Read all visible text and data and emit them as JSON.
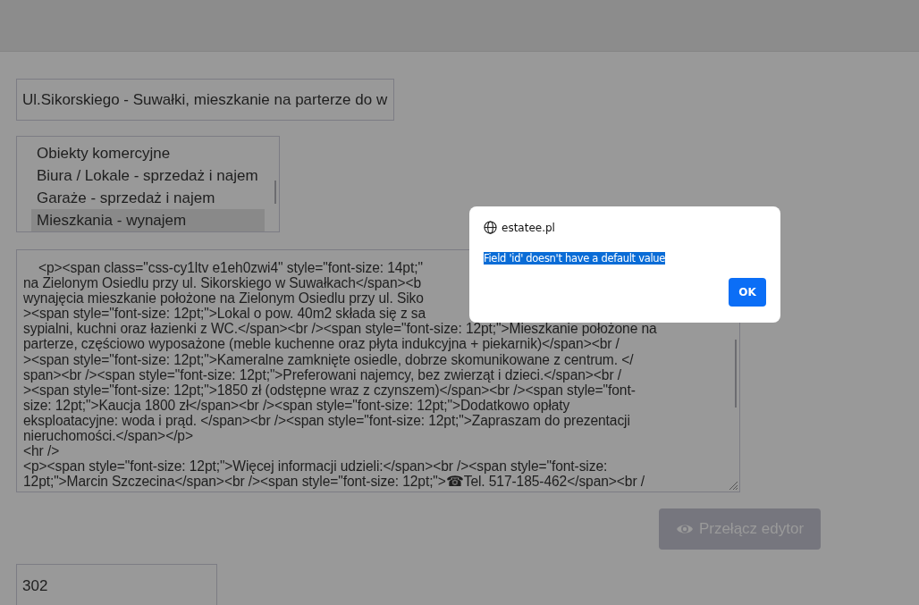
{
  "title_field": {
    "value": "Ul.Sikorskiego - Suwałki, mieszkanie na parterze do w"
  },
  "category_list": {
    "items": [
      {
        "label": "Obiekty komercyjne",
        "selected": false
      },
      {
        "label": "Biura / Lokale - sprzedaż i najem",
        "selected": false
      },
      {
        "label": "Garaże - sprzedaż i najem",
        "selected": false
      },
      {
        "label": "Mieszkania - wynajem",
        "selected": true
      }
    ]
  },
  "html_editor": {
    "lines": [
      "<p><span class=\"css-cy1ltv e1eh0zwi4\" style=\"font-size: 14pt;\"",
      "na Zielonym Osiedlu przy ul. Sikorskiego w Suwałkach</span><b",
      "wynajęcia mieszkanie położone na Zielonym Osiedlu przy ul. Siko",
      "><span style=\"font-size: 12pt;\">Lokal o pow. 40m2 składa się z sa",
      "sypialni, kuchni oraz łazienki z WC.</span><br /><span style=\"font-size: 12pt;\">Mieszkanie położone na",
      "parterze, częściowo wyposażone (meble kuchenne oraz płyta indukcyjna + piekarnik)</span><br /",
      "><span style=\"font-size: 12pt;\">Kameralne zamknięte osiedle, dobrze skomunikowane z centrum. </",
      "span><br /><span style=\"font-size: 12pt;\">Preferowani najemcy, bez zwierząt i dzieci.</span><br /",
      "><span style=\"font-size: 12pt;\">1850 zł (odstępne wraz z czynszem)</span><br /><span style=\"font-",
      "size: 12pt;\">Kaucja 1800 zł</span><br /><span style=\"font-size: 12pt;\">Dodatkowo opłaty",
      "eksploatacyjne: woda i prąd. </span><br /><span style=\"font-size: 12pt;\">Zapraszam do prezentacji",
      "nieruchomości.</span></p>",
      "<hr />",
      "<p><span style=\"font-size: 12pt;\">Więcej informacji udzieli:</span><br /><span style=\"font-size:",
      "12pt;\">Marcin Szczecina</span><br /><span style=\"font-size: 12pt;\">☎Tel. 517-185-462</span><br /"
    ]
  },
  "toggle_button": {
    "label": "Przełącz edytor",
    "disabled": true
  },
  "id_field": {
    "value": "302"
  },
  "dialog": {
    "origin": "estatee.pl",
    "message": "Field 'id' doesn't have a default value",
    "message_highlighted": true,
    "button": "OK"
  }
}
